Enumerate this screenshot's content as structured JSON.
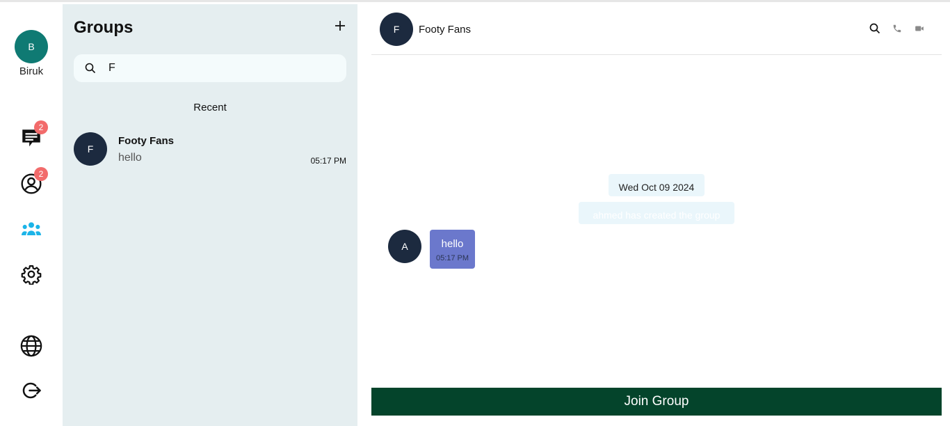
{
  "user": {
    "initial": "B",
    "name": "Biruk"
  },
  "nav": {
    "chats_badge": "2",
    "contacts_badge": "2"
  },
  "groups": {
    "title": "Groups",
    "search_value": "F",
    "recent_label": "Recent",
    "items": [
      {
        "initial": "F",
        "name": "Footy Fans",
        "last_message": "hello",
        "time": "05:17 PM"
      }
    ]
  },
  "chat": {
    "avatar_initial": "F",
    "title": "Footy Fans",
    "date_label": "Wed Oct 09 2024",
    "system_message": "ahmed has created the group",
    "messages": [
      {
        "sender_initial": "A",
        "text": "hello",
        "time": "05:17 PM"
      }
    ],
    "join_label": "Join Group"
  },
  "colors": {
    "accent": "#1cb4e8",
    "join_button": "#04442b",
    "bubble": "#6b78cc",
    "badge": "#f26b6b",
    "user_avatar": "#0f7a73",
    "dark_avatar": "#1c2a3f"
  },
  "icons": [
    "chat-icon",
    "contacts-icon",
    "groups-icon",
    "settings-icon",
    "globe-icon",
    "logout-icon",
    "plus-icon",
    "search-icon",
    "phone-icon",
    "video-icon"
  ]
}
